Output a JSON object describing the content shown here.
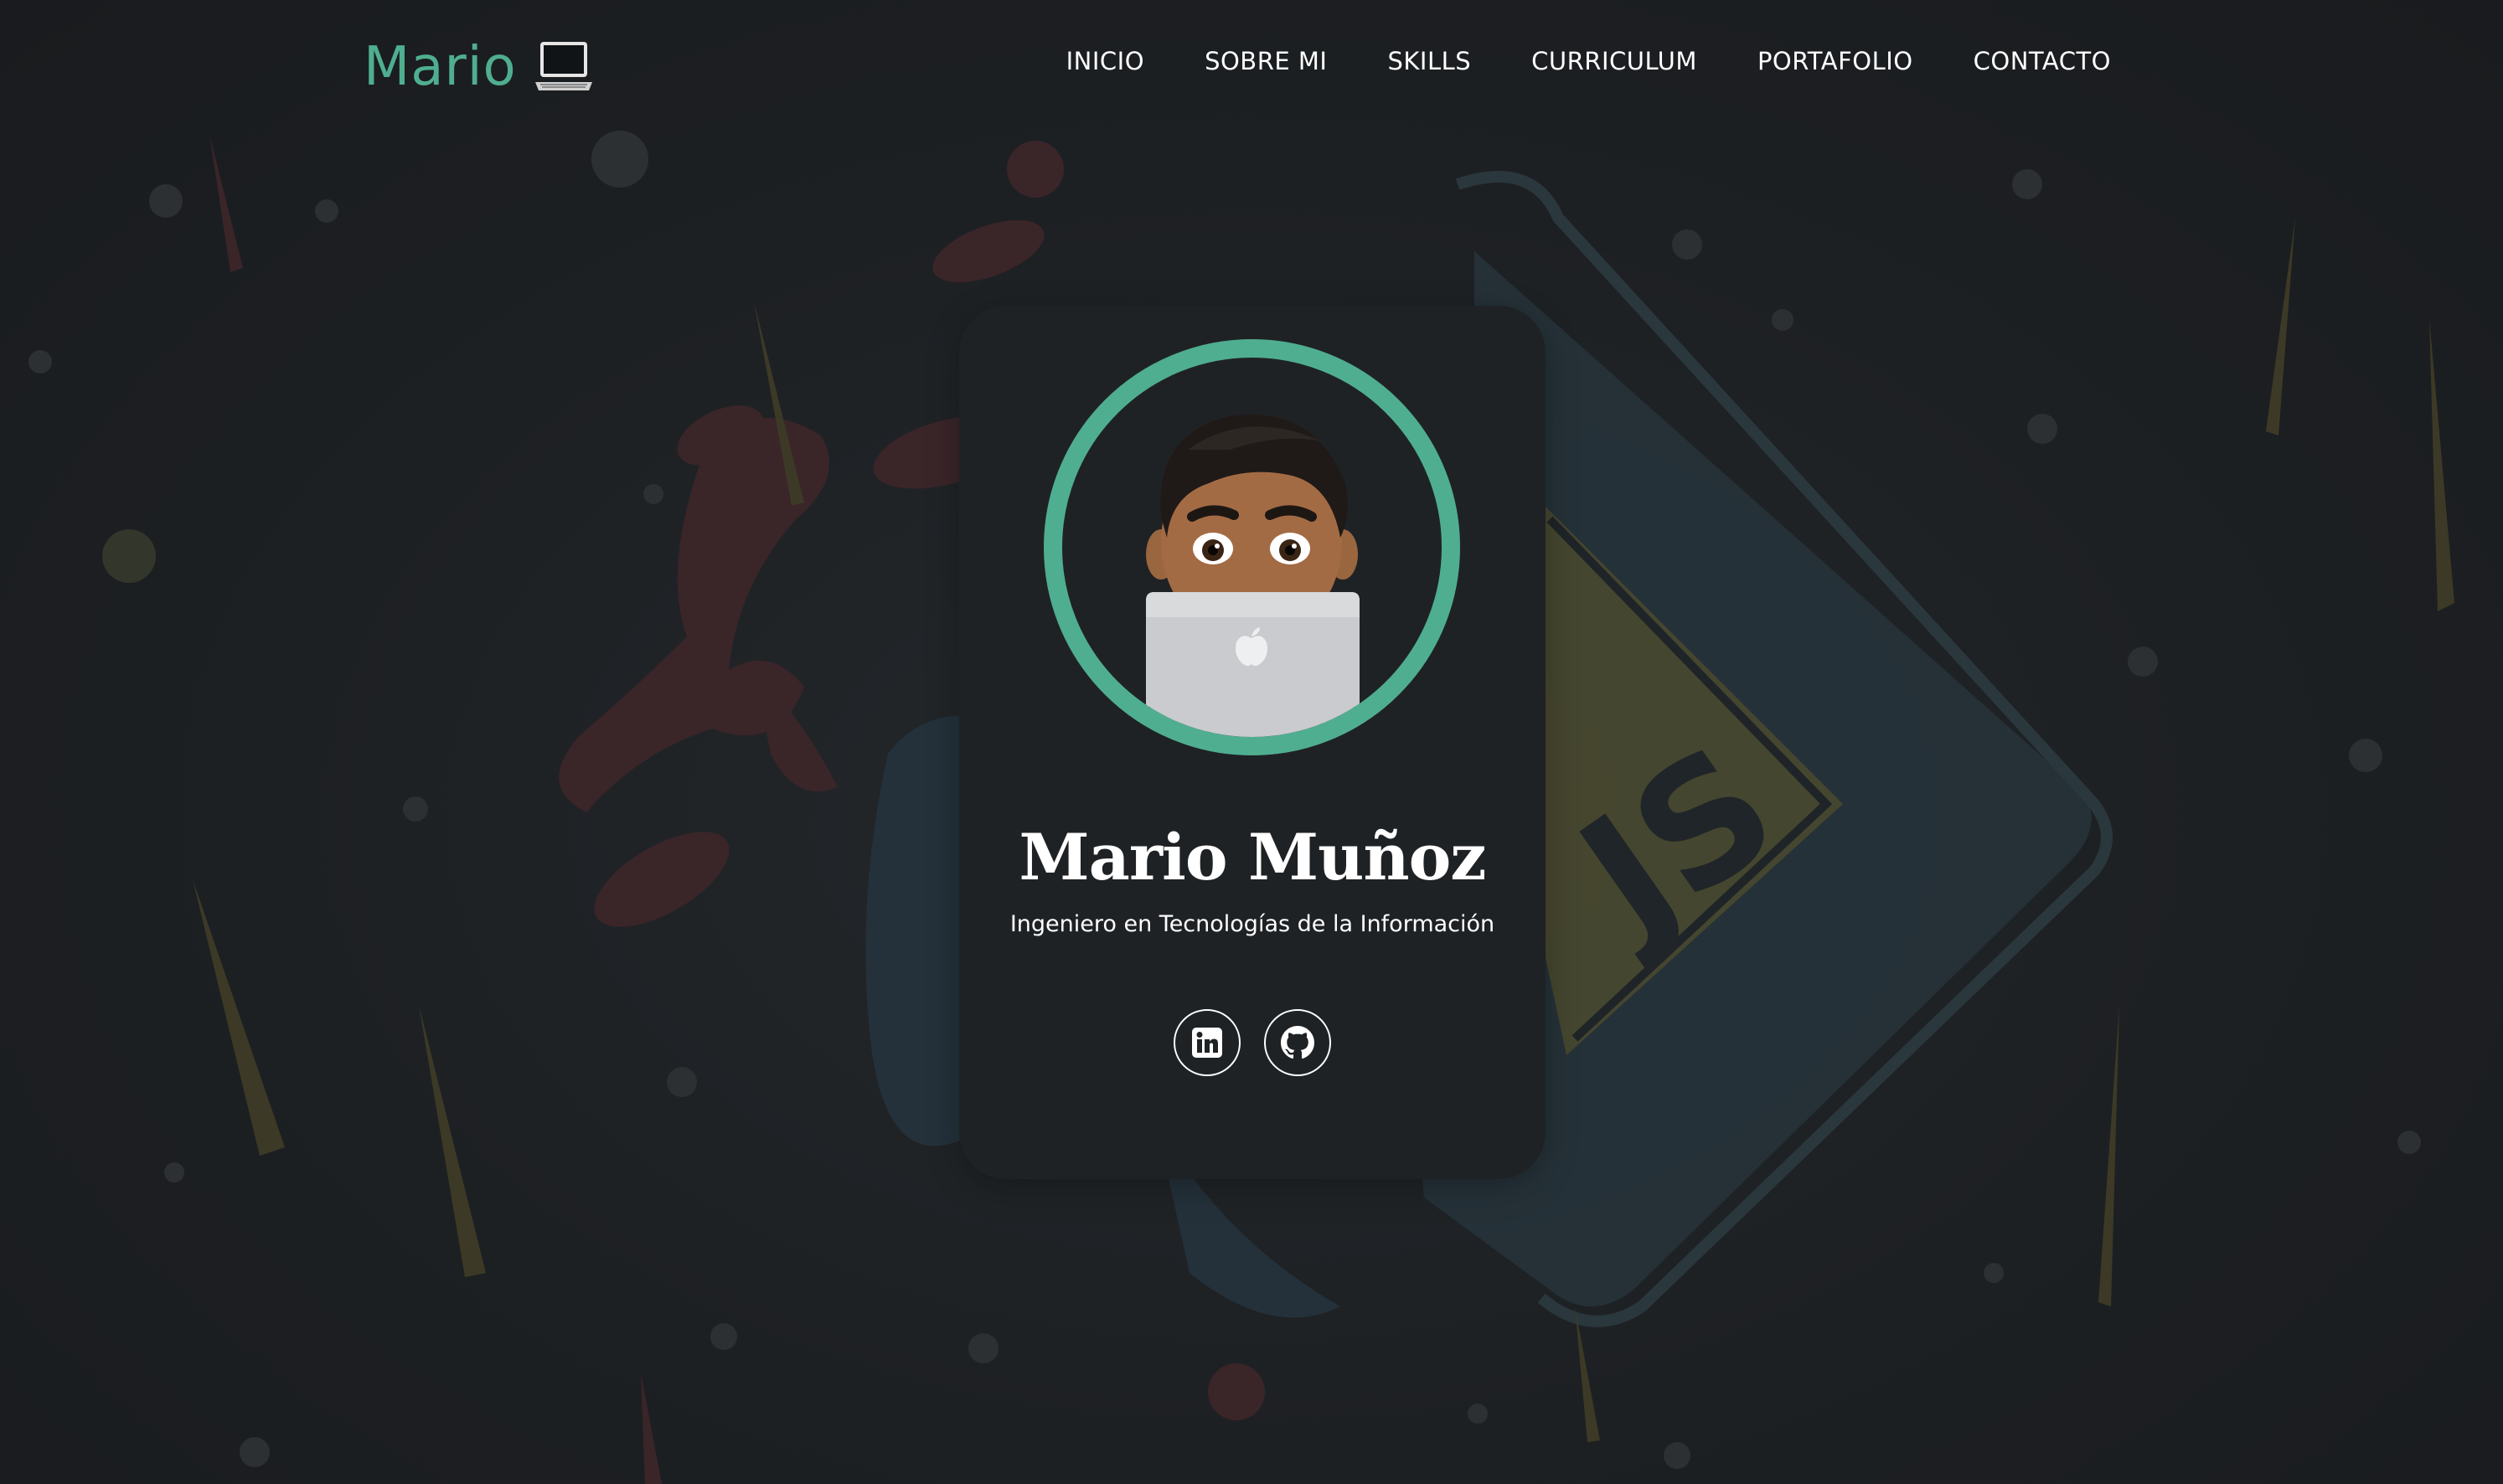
{
  "header": {
    "brand": "Mario",
    "brand_icon": "laptop-icon",
    "nav": [
      {
        "label": "INICIO"
      },
      {
        "label": "SOBRE MI"
      },
      {
        "label": "SKILLS"
      },
      {
        "label": "CURRICULUM"
      },
      {
        "label": "PORTAFOLIO"
      },
      {
        "label": "CONTACTO"
      }
    ]
  },
  "profile": {
    "name": "Mario Muñoz",
    "subtitle": "Ingeniero en Tecnologías de la Información",
    "avatar": "memoji-avatar-with-laptop",
    "socials": [
      {
        "icon": "linkedin-icon"
      },
      {
        "icon": "github-icon"
      }
    ]
  },
  "colors": {
    "accent": "#4fae8f",
    "background": "#1c1e21",
    "card": "#1f2225",
    "text": "#ffffff"
  }
}
